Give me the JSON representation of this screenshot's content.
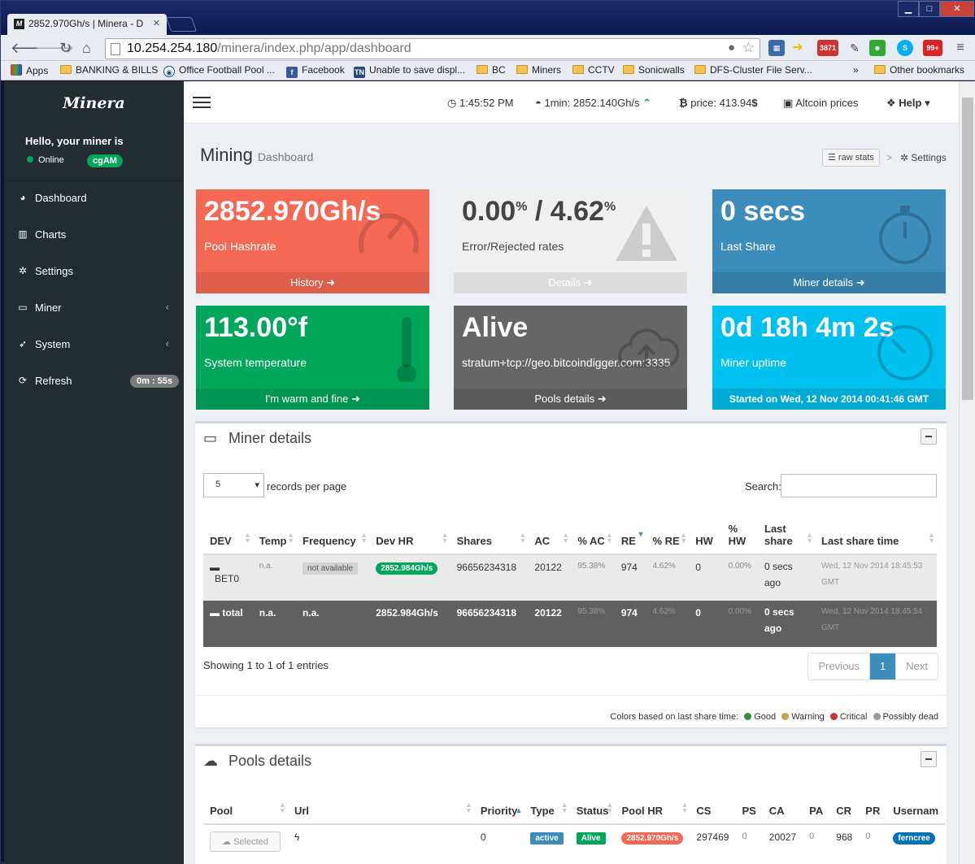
{
  "browser": {
    "tab_title": "2852.970Gh/s | Minera - D",
    "favicon_text": "M",
    "url_host": "10.254.254.180",
    "url_path": "/minera/index.php/app/dashboard",
    "extension_badges": {
      "mail": "3871",
      "other": "99+"
    },
    "bookmarks": [
      {
        "label": "Apps",
        "icon": "apps-grid-icon"
      },
      {
        "label": "BANKING & BILLS",
        "icon": "folder-icon"
      },
      {
        "label": "Office Football Pool ...",
        "icon": "eye-icon"
      },
      {
        "label": "Facebook",
        "icon": "facebook-icon"
      },
      {
        "label": "Unable to save displ...",
        "icon": "tn-icon"
      },
      {
        "label": "BC",
        "icon": "folder-icon"
      },
      {
        "label": "Miners",
        "icon": "folder-icon"
      },
      {
        "label": "CCTV",
        "icon": "folder-icon"
      },
      {
        "label": "Sonicwalls",
        "icon": "folder-icon"
      },
      {
        "label": "DFS-Cluster File Serv...",
        "icon": "folder-icon"
      }
    ],
    "overflow": "»",
    "other_bookmarks": "Other bookmarks"
  },
  "sidebar": {
    "logo": "Minera",
    "hello": "Hello, your miner is",
    "status": "Online",
    "miner_type": "cgAM",
    "items": [
      {
        "label": "Dashboard",
        "icon": "dashboard-icon"
      },
      {
        "label": "Charts",
        "icon": "bar-chart-icon"
      },
      {
        "label": "Settings",
        "icon": "gear-icon"
      },
      {
        "label": "Miner",
        "icon": "desktop-icon",
        "arrow": "‹"
      },
      {
        "label": "System",
        "icon": "rocket-icon",
        "arrow": "‹"
      },
      {
        "label": "Refresh",
        "icon": "refresh-icon",
        "badge": "0m : 55s"
      }
    ]
  },
  "topnav": {
    "time": "1:45:52 PM",
    "hashrate_1min": "1min: 2852.140Gh/s",
    "price": "price: 413.94",
    "price_symbol": "$",
    "altcoin": "Altcoin prices",
    "help": "Help"
  },
  "header": {
    "title": "Mining",
    "subtitle": "Dashboard",
    "raw_stats": "raw stats",
    "settings": "Settings"
  },
  "boxes": {
    "hashrate": {
      "value": "2852.970Gh/s",
      "label": "Pool Hashrate",
      "footer": "History",
      "color": "#f56954"
    },
    "errors": {
      "value_a": "0.00",
      "value_b": "4.62",
      "pct": "%",
      "sep": " / ",
      "label": "Error/Rejected rates",
      "footer": "Details",
      "color": "#f0f0f0"
    },
    "last_share": {
      "value": "0 secs",
      "label": "Last Share",
      "footer": "Miner details",
      "color": "#3c8dbc"
    },
    "temperature": {
      "value": "113.00°f",
      "label": "System temperature",
      "footer": "I'm warm and fine",
      "color": "#00a65a"
    },
    "pool": {
      "value": "Alive",
      "label": "stratum+tcp://geo.bitcoindigger.com:3335",
      "footer": "Pools details",
      "color": "#666666"
    },
    "uptime": {
      "value": "0d 18h 4m 2s",
      "label": "Miner uptime",
      "footer": "Started on Wed, 12 Nov 2014 00:41:46 GMT",
      "color": "#00c0ef"
    }
  },
  "miner_details": {
    "title": "Miner details",
    "per_page_value": "5",
    "per_page_label": "records per page",
    "search_label": "Search:",
    "columns": [
      "DEV",
      "Temp",
      "Frequency",
      "Dev HR",
      "Shares",
      "AC",
      "% AC",
      "RE",
      "% RE",
      "HW",
      "% HW",
      "Last share",
      "Last share time"
    ],
    "row": {
      "dev": "BET0",
      "temp": "n.a.",
      "freq": "not available",
      "devhr": "2852.984Gh/s",
      "shares": "96656234318",
      "ac": "20122",
      "pac": "95.38%",
      "re": "974",
      "pre": "4.62%",
      "hw": "0",
      "phw": "0.00%",
      "last": "0 secs ago",
      "time": "Wed, 12 Nov 2014 18:45:53 GMT"
    },
    "total": {
      "dev": "total",
      "temp": "n.a.",
      "freq": "n.a.",
      "devhr": "2852.984Gh/s",
      "shares": "96656234318",
      "ac": "20122",
      "pac": "95.38%",
      "re": "974",
      "pre": "4.62%",
      "hw": "0",
      "phw": "0.00%",
      "last": "0 secs ago",
      "time": "Wed, 12 Nov 2014 18:45:54 GMT"
    },
    "showing": "Showing 1 to 1 of 1 entries",
    "pager": {
      "prev": "Previous",
      "page": "1",
      "next": "Next"
    },
    "legend": {
      "intro": "Colors based on last share time:",
      "good": "Good",
      "warning": "Warning",
      "critical": "Critical",
      "dead": "Possibly dead"
    }
  },
  "pools_details": {
    "title": "Pools details",
    "columns": [
      "Pool",
      "Url",
      "Priority",
      "Type",
      "Status",
      "Pool HR",
      "CS",
      "PS",
      "CA",
      "PA",
      "CR",
      "PR",
      "Usernam"
    ],
    "row": {
      "pool": "Selected",
      "url": "ϟ",
      "priority": "0",
      "type": "active",
      "status": "Alive",
      "hr": "2852.970Gh/s",
      "cs": "297469",
      "ps": "0",
      "ca": "20027",
      "pa": "0",
      "cr": "968",
      "pr": "0",
      "user": "ferncree"
    }
  }
}
